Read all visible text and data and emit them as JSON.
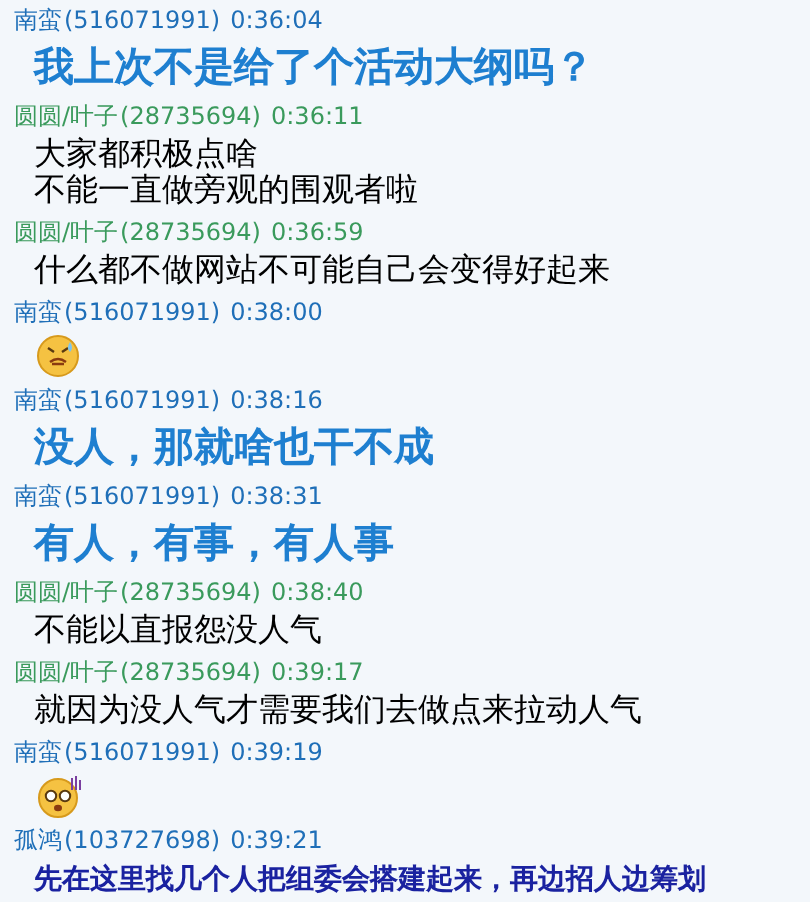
{
  "messages": [
    {
      "author": "南蛮",
      "id_text": "(516071991)",
      "time": "0:36:04",
      "color": "#1f6fb8",
      "kind": "big",
      "lines": [
        "我上次不是给了个活动大纲吗？"
      ]
    },
    {
      "author": "圆圆/叶子",
      "id_text": "(28735694)",
      "time": "0:36:11",
      "color": "#3a9a5c",
      "kind": "plain",
      "lines": [
        "大家都积极点啥",
        "不能一直做旁观的围观者啦"
      ]
    },
    {
      "author": "圆圆/叶子",
      "id_text": "(28735694)",
      "time": "0:36:59",
      "color": "#3a9a5c",
      "kind": "plain",
      "lines": [
        "什么都不做网站不可能自己会变得好起来"
      ]
    },
    {
      "author": "南蛮",
      "id_text": "(516071991)",
      "time": "0:38:00",
      "color": "#1f6fb8",
      "kind": "sweat"
    },
    {
      "author": "南蛮",
      "id_text": "(516071991)",
      "time": "0:38:16",
      "color": "#1f6fb8",
      "kind": "big",
      "lines": [
        "没人，那就啥也干不成"
      ]
    },
    {
      "author": "南蛮",
      "id_text": "(516071991)",
      "time": "0:38:31",
      "color": "#1f6fb8",
      "kind": "big",
      "lines": [
        "有人，有事，有人事"
      ]
    },
    {
      "author": "圆圆/叶子",
      "id_text": "(28735694)",
      "time": "0:38:40",
      "color": "#3a9a5c",
      "kind": "plain",
      "lines": [
        "不能以直报怨没人气"
      ]
    },
    {
      "author": "圆圆/叶子",
      "id_text": "(28735694)",
      "time": "0:39:17",
      "color": "#3a9a5c",
      "kind": "plain",
      "lines": [
        "就因为没人气才需要我们去做点来拉动人气"
      ]
    },
    {
      "author": "南蛮",
      "id_text": "(516071991)",
      "time": "0:39:19",
      "color": "#1f6fb8",
      "kind": "shock"
    },
    {
      "author": "孤鸿",
      "id_text": "(103727698)",
      "time": "0:39:21",
      "color": "#1f6fb8",
      "kind": "navy",
      "lines": [
        "先在这里找几个人把组委会搭建起来，再边招人边筹划"
      ]
    }
  ]
}
